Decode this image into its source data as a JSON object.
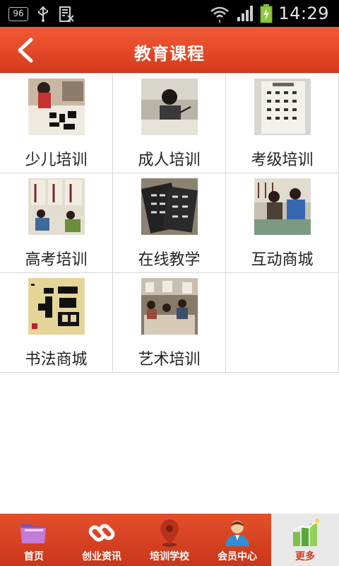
{
  "status_bar": {
    "badge": "96",
    "time": "14:29"
  },
  "header": {
    "title": "教育课程"
  },
  "grid": {
    "items": [
      {
        "label": "少儿培训"
      },
      {
        "label": "成人培训"
      },
      {
        "label": "考级培训"
      },
      {
        "label": "高考培训"
      },
      {
        "label": "在线教学"
      },
      {
        "label": "互动商城"
      },
      {
        "label": "书法商城"
      },
      {
        "label": "艺术培训"
      }
    ]
  },
  "tab_bar": {
    "items": [
      {
        "label": "首页",
        "icon": "folder-icon"
      },
      {
        "label": "创业资讯",
        "icon": "link-icon"
      },
      {
        "label": "培训学校",
        "icon": "map-pin-icon"
      },
      {
        "label": "会员中心",
        "icon": "user-icon"
      },
      {
        "label": "更多",
        "icon": "chart-icon",
        "active": true
      }
    ]
  },
  "colors": {
    "accent": "#e34a27",
    "active_tab_bg": "#e8e8e8"
  }
}
